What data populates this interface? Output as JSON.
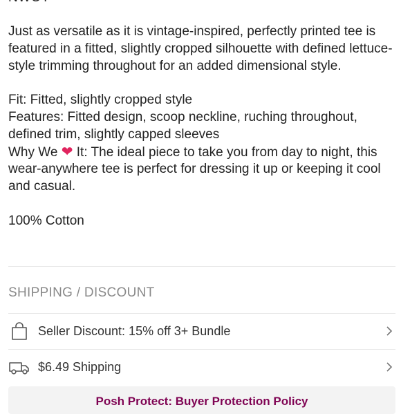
{
  "top_partial_text": "NWOT",
  "description": {
    "paragraph1": "Just as versatile as it is vintage-inspired, perfectly printed tee is featured in a fitted, slightly cropped silhouette with defined lettuce-style trimming throughout for an added dimensional style.",
    "fit": "Fit: Fitted, slightly cropped style",
    "features": "Features: Fitted design, scoop neckline, ruching throughout, defined trim, slightly capped sleeves",
    "why_prefix": "Why We",
    "why_icon": "red-heart-emoji",
    "why_rest": " It: The ideal piece to take you from day to night, this wear-anywhere tee is perfect for dressing it up or keeping it cool and casual.",
    "material": "100% Cotton"
  },
  "shipping": {
    "section_title": "SHIPPING / DISCOUNT",
    "items": [
      {
        "icon": "shopping-bag-icon",
        "label": "Seller Discount: 15% off 3+ Bundle"
      },
      {
        "icon": "delivery-truck-icon",
        "label": "$6.49 Shipping"
      }
    ]
  },
  "bottom_button": {
    "label": "Posh Protect: Buyer Protection Policy"
  },
  "colors": {
    "text": "#222222",
    "muted": "#8a8a8a",
    "divider": "#e8e8e8",
    "accent": "#7f0353",
    "heart": "#e0245e"
  }
}
